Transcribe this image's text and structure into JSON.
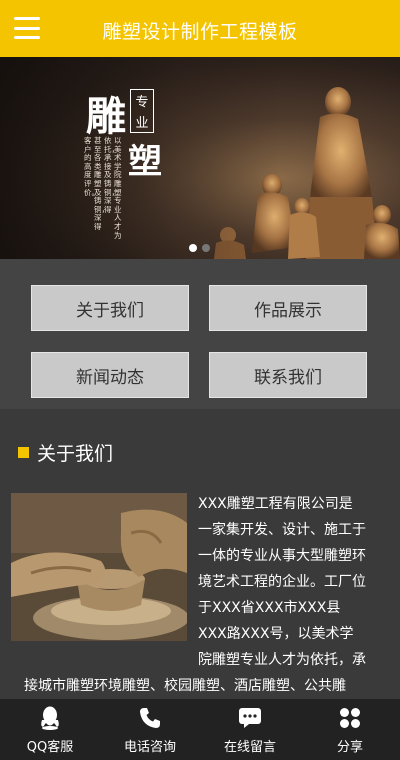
{
  "header": {
    "title": "雕塑设计制作工程模板",
    "menu_icon": "hamburger-menu-icon"
  },
  "banner": {
    "big_char_1": "雕",
    "big_char_2": "塑",
    "seal_1": "专",
    "seal_2": "业",
    "col_1": "以美术学院雕塑专业人才为",
    "col_2": "依托，承接及铸铜，深得",
    "col_3": "甚至各类雕塑及铸铜，深得",
    "col_4": "客户的高度评价。",
    "slides_count": 2,
    "active_slide": 1
  },
  "nav": {
    "items": [
      {
        "label": "关于我们"
      },
      {
        "label": "作品展示"
      },
      {
        "label": "新闻动态"
      },
      {
        "label": "联系我们"
      }
    ]
  },
  "about": {
    "title": "关于我们",
    "text": "XXX雕塑工程有限公司是一家集开发、设计、施工于一体的专业从事大型雕塑环境艺术工程的企业。工厂位于XXX省XXX市XXX县XXX路XXX号，以美术学院雕塑专业人才为依托，承接城市雕塑环境雕塑、校园雕塑、酒店雕塑、公共雕塑、主题雕塑等。"
  },
  "footer": {
    "items": [
      {
        "label": "QQ客服",
        "icon": "qq-icon"
      },
      {
        "label": "电话咨询",
        "icon": "phone-icon"
      },
      {
        "label": "在线留言",
        "icon": "message-icon"
      },
      {
        "label": "分享",
        "icon": "share-icon"
      }
    ]
  },
  "colors": {
    "accent": "#f5c400",
    "background": "#3a3a3a",
    "button": "#c9c9c9",
    "footer": "#222222"
  }
}
